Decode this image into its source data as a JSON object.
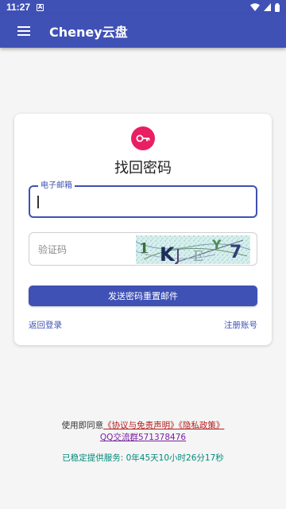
{
  "status_bar": {
    "time": "11:27",
    "notification_glyph": "A"
  },
  "app_bar": {
    "title": "Cheney云盘",
    "menu_icon": "menu-icon"
  },
  "card": {
    "icon": "key-icon",
    "title": "找回密码",
    "email": {
      "label": "电子邮箱",
      "value": ""
    },
    "captcha": {
      "placeholder": "验证码",
      "image_text": "1 KJ EY 7"
    },
    "send_button": "发送密码重置邮件",
    "back_link": "返回登录",
    "register_link": "注册账号"
  },
  "footer": {
    "agree_prefix": "使用即同意",
    "agreement": "《协议与免责声明》《隐私政策》",
    "qq_group": "QQ交流群571378476",
    "uptime": "已稳定提供服务: 0年45天10小时26分17秒"
  },
  "colors": {
    "primary": "#3f51b5",
    "accent": "#e91e63",
    "agreement": "#b71c1c",
    "qq": "#7b1fa2",
    "uptime": "#00897b"
  }
}
